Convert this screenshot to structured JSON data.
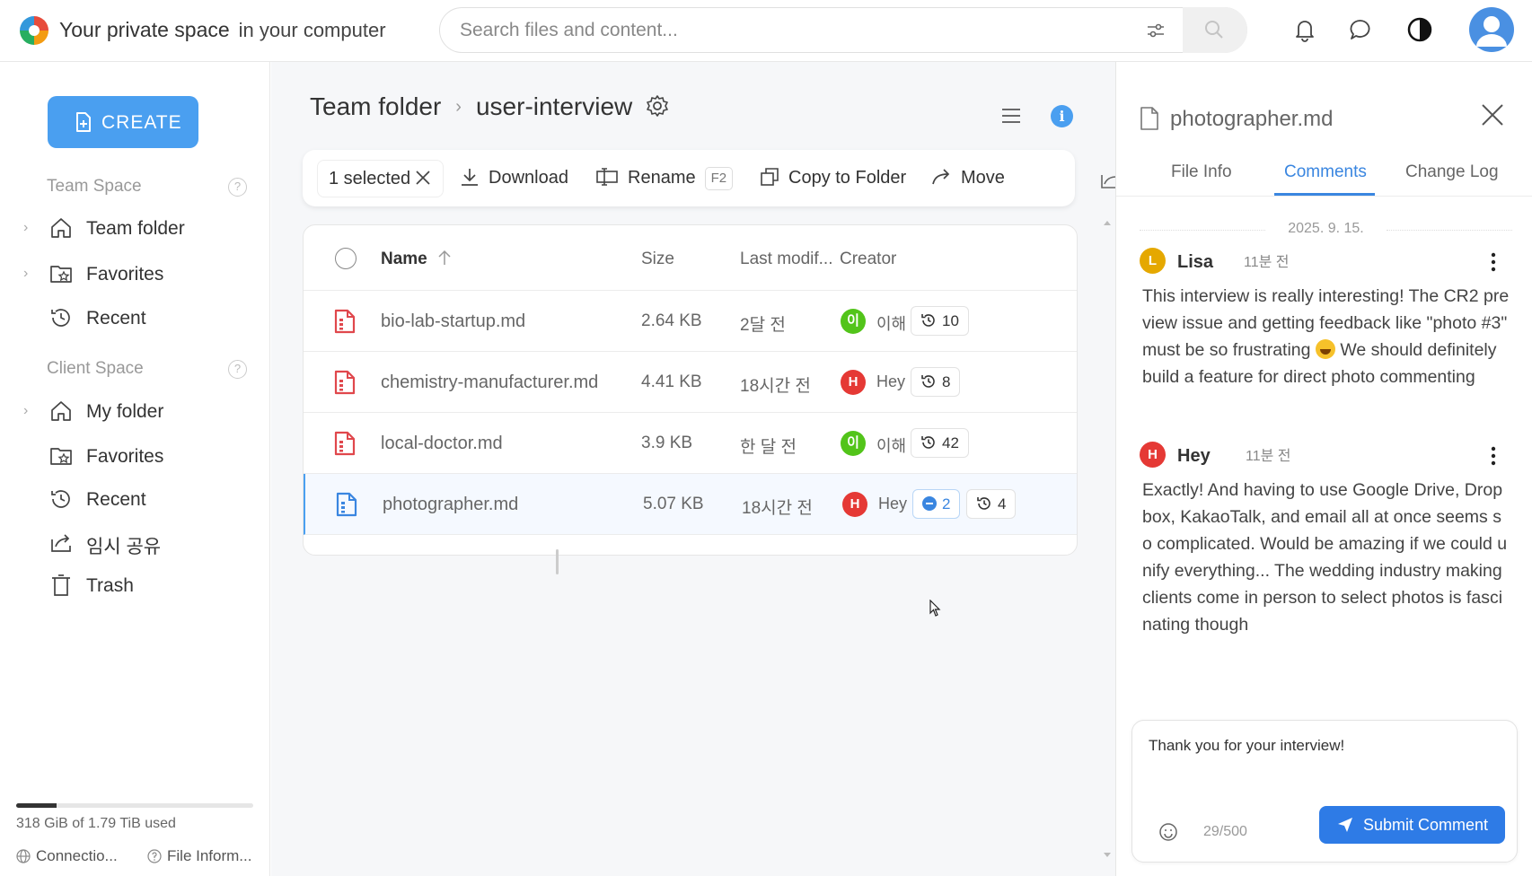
{
  "header": {
    "app_name": "Your private space",
    "app_tagline": "in your computer",
    "search_placeholder": "Search files and content..."
  },
  "sidebar": {
    "create_label": "CREATE",
    "team_space_label": "Team Space",
    "client_space_label": "Client Space",
    "help_glyph": "?",
    "team_items": [
      {
        "label": "Team folder",
        "icon": "home-icon"
      },
      {
        "label": "Favorites",
        "icon": "star-folder-icon"
      },
      {
        "label": "Recent",
        "icon": "history-icon"
      }
    ],
    "client_items": [
      {
        "label": "My folder",
        "icon": "home-icon"
      },
      {
        "label": "Favorites",
        "icon": "star-folder-icon"
      },
      {
        "label": "Recent",
        "icon": "history-icon"
      },
      {
        "label": "임시 공유",
        "icon": "share-icon"
      },
      {
        "label": "Trash",
        "icon": "trash-icon"
      }
    ],
    "storage_text": "318 GiB of 1.79 TiB used",
    "storage_fraction": 0.17,
    "footer_connection": "Connectio...",
    "footer_file_info": "File Inform..."
  },
  "main": {
    "breadcrumb": {
      "root": "Team folder",
      "current": "user-interview"
    },
    "info_glyph": "i",
    "toolbar": {
      "selected_label": "1 selected",
      "download_label": "Download",
      "rename_label": "Rename",
      "rename_shortcut": "F2",
      "copy_label": "Copy to Folder",
      "move_label": "Move"
    },
    "columns": {
      "name": "Name",
      "size": "Size",
      "modified": "Last modif...",
      "creator": "Creator"
    },
    "files": [
      {
        "name": "bio-lab-startup.md",
        "size": "2.64 KB",
        "modified": "2달 전",
        "creator_initial": "이",
        "creator": "이해",
        "creator_color": "#52c41a",
        "versions": "10",
        "comments": null,
        "selected": false
      },
      {
        "name": "chemistry-manufacturer.md",
        "size": "4.41 KB",
        "modified": "18시간 전",
        "creator_initial": "H",
        "creator": "Hey",
        "creator_color": "#e53935",
        "versions": "8",
        "comments": null,
        "selected": false
      },
      {
        "name": "local-doctor.md",
        "size": "3.9 KB",
        "modified": "한 달 전",
        "creator_initial": "이",
        "creator": "이해",
        "creator_color": "#52c41a",
        "versions": "42",
        "comments": null,
        "selected": false
      },
      {
        "name": "photographer.md",
        "size": "5.07 KB",
        "modified": "18시간 전",
        "creator_initial": "H",
        "creator": "Hey",
        "creator_color": "#e53935",
        "versions": "4",
        "comments": "2",
        "selected": true
      }
    ]
  },
  "panel": {
    "file_name": "photographer.md",
    "tabs": {
      "file_info": "File Info",
      "comments": "Comments",
      "change_log": "Change Log"
    },
    "active_tab": "Comments",
    "date": "2025. 9. 15.",
    "comments": [
      {
        "author": "Lisa",
        "initial": "L",
        "color": "#e5a800",
        "time": "11분 전",
        "text_before_emoji": "This interview is really interesting! The CR2 preview issue and getting feedback like \"photo #3\" must be so frustrating ",
        "text_after_emoji": " We should definitely build a feature for direct photo commenting"
      },
      {
        "author": "Hey",
        "initial": "H",
        "color": "#e53935",
        "time": "11분 전",
        "text": "Exactly! And having to use Google Drive, Dropbox, KakaoTalk, and email all at once seems so complicated. Would be amazing if we could unify everything... The wedding industry making clients come in person to select photos is fascinating though"
      }
    ],
    "composer": {
      "value": "Thank you for your interview!",
      "counter": "29/500",
      "submit_label": "Submit Comment"
    }
  },
  "colors": {
    "accent": "#4a9ff0",
    "primary_button": "#2e7be6",
    "file_icon_red": "#e0474c",
    "file_icon_blue": "#3a86e0"
  }
}
